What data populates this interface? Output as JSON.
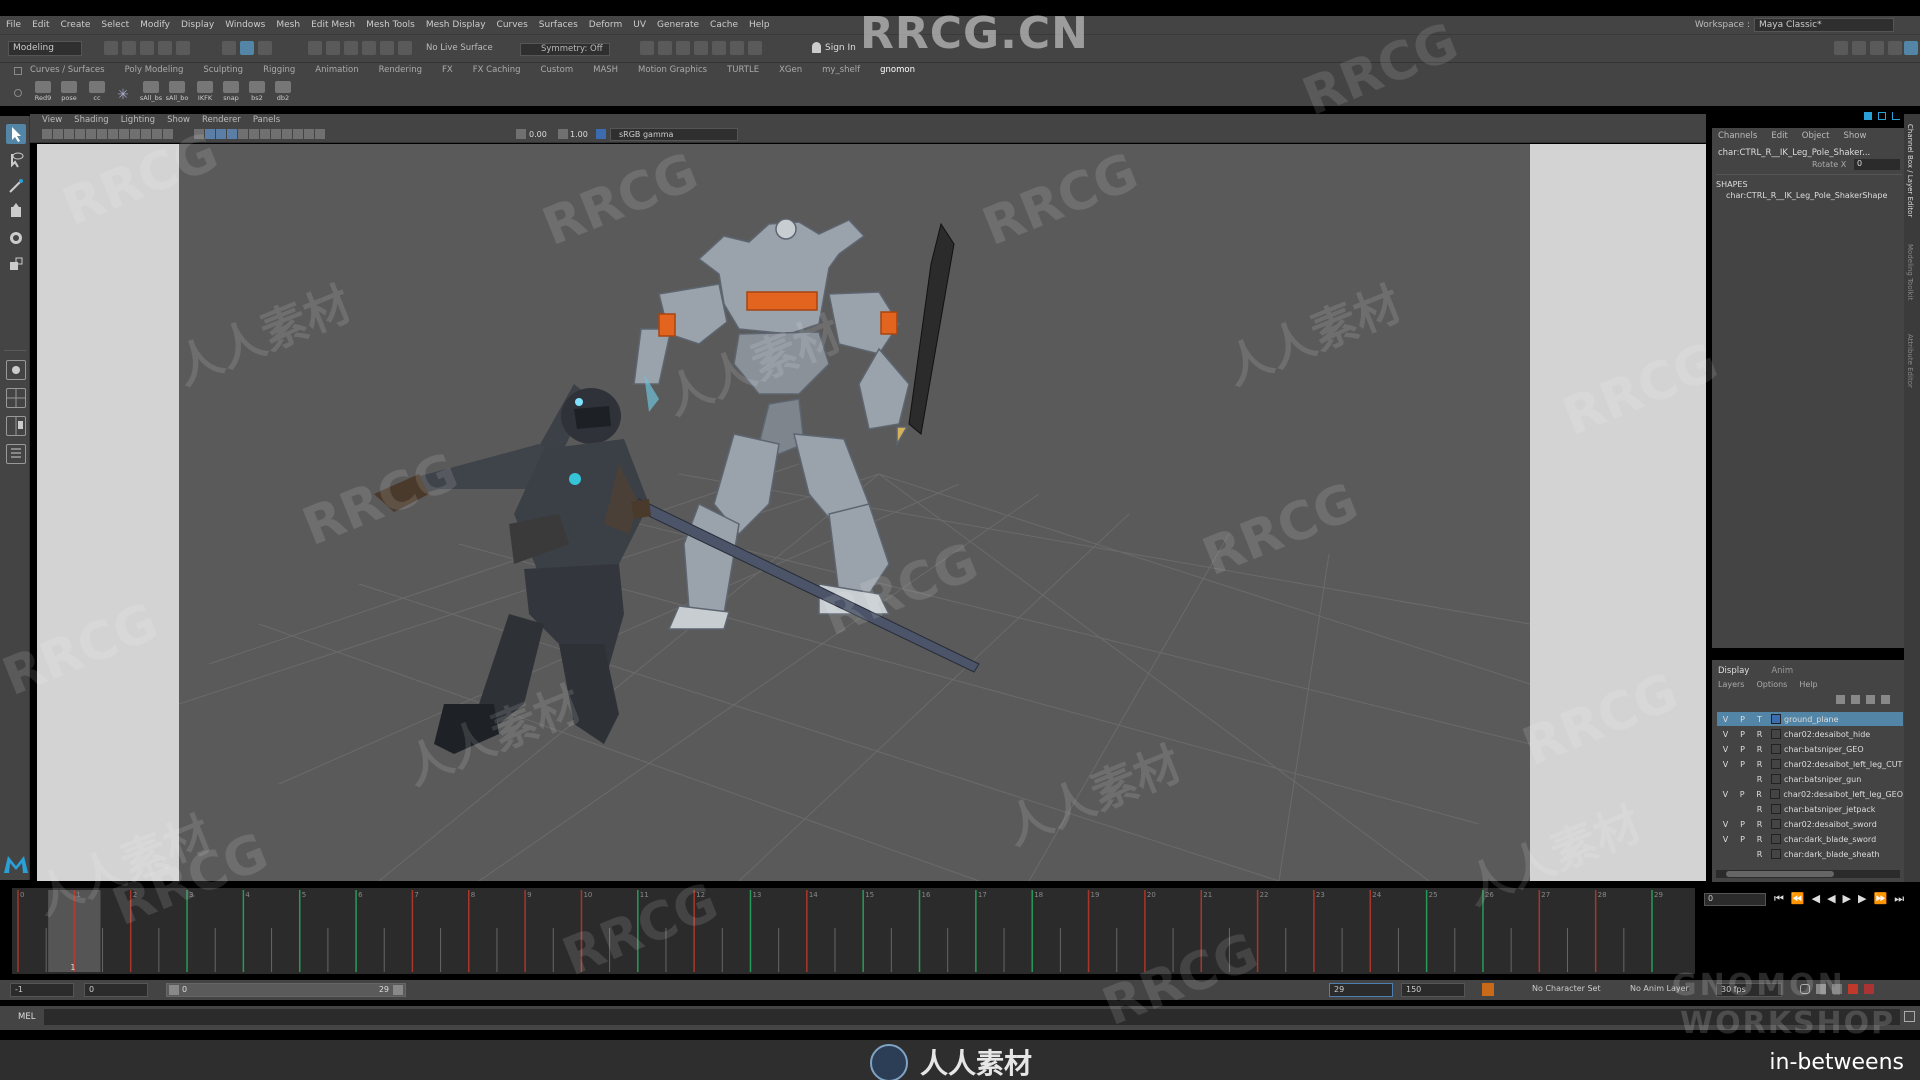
{
  "top_watermark": "RRCG.CN",
  "menus": [
    "File",
    "Edit",
    "Create",
    "Select",
    "Modify",
    "Display",
    "Windows",
    "Mesh",
    "Edit Mesh",
    "Mesh Tools",
    "Mesh Display",
    "Curves",
    "Surfaces",
    "Deform",
    "UV",
    "Generate",
    "Cache",
    "Help"
  ],
  "workspace": {
    "label": "Workspace :",
    "value": "Maya Classic*"
  },
  "status_line": {
    "mode": "Modeling",
    "live_surface": "No Live Surface",
    "symmetry": "Symmetry: Off",
    "sign_in": "Sign In"
  },
  "shelf": {
    "tabs": [
      "Curves / Surfaces",
      "Poly Modeling",
      "Sculpting",
      "Rigging",
      "Animation",
      "Rendering",
      "FX",
      "FX Caching",
      "Custom",
      "MASH",
      "Motion Graphics",
      "TURTLE",
      "XGen",
      "my_shelf",
      "gnomon"
    ],
    "active_tab": "gnomon",
    "buttons": [
      "Red9",
      "pose",
      "cc",
      "",
      "sAll_bs",
      "sAll_bo",
      "IKFK",
      "snap",
      "bs2",
      "db2"
    ]
  },
  "panel_menu": [
    "View",
    "Shading",
    "Lighting",
    "Show",
    "Renderer",
    "Panels"
  ],
  "panel_toolbar": {
    "exposure": "0.00",
    "gamma": "1.00",
    "color_space": "sRGB gamma"
  },
  "channel_box": {
    "tabs": [
      "Channels",
      "Edit",
      "Object",
      "Show"
    ],
    "object": "char:CTRL_R__IK_Leg_Pole_Shaker...",
    "attribute": {
      "name": "Rotate X",
      "value": "0"
    },
    "shapes_heading": "SHAPES",
    "shape": "char:CTRL_R__IK_Leg_Pole_ShakerShape"
  },
  "side_tabs": [
    "Channel Box / Layer Editor",
    "Modeling Toolkit",
    "Attribute Editor"
  ],
  "layer_editor": {
    "tabs": [
      "Display",
      "Anim"
    ],
    "menus": [
      "Layers",
      "Options",
      "Help"
    ],
    "layers": [
      {
        "v": "V",
        "p": "P",
        "r": "T",
        "name": "ground_plane",
        "color": "#3b6cb0",
        "selected": true
      },
      {
        "v": "V",
        "p": "P",
        "r": "R",
        "name": "char02:desaibot_hide",
        "color": "#444",
        "selected": false
      },
      {
        "v": "V",
        "p": "P",
        "r": "R",
        "name": "char:batsniper_GEO",
        "color": "#444",
        "selected": false
      },
      {
        "v": "V",
        "p": "P",
        "r": "R",
        "name": "char02:desaibot_left_leg_CUT",
        "color": "#444",
        "selected": false
      },
      {
        "v": "",
        "p": "",
        "r": "R",
        "name": "char:batsniper_gun",
        "color": "#444",
        "selected": false
      },
      {
        "v": "V",
        "p": "P",
        "r": "R",
        "name": "char02:desaibot_left_leg_GEO",
        "color": "#444",
        "selected": false
      },
      {
        "v": "",
        "p": "",
        "r": "R",
        "name": "char:batsniper_jetpack",
        "color": "#444",
        "selected": false
      },
      {
        "v": "V",
        "p": "P",
        "r": "R",
        "name": "char02:desaibot_sword",
        "color": "#444",
        "selected": false
      },
      {
        "v": "V",
        "p": "P",
        "r": "R",
        "name": "char:dark_blade_sword",
        "color": "#444",
        "selected": false
      },
      {
        "v": "",
        "p": "",
        "r": "R",
        "name": "char:dark_blade_sheath",
        "color": "#444",
        "selected": false
      }
    ]
  },
  "timeline": {
    "frames": [
      "0",
      "1",
      "2",
      "3",
      "4",
      "5",
      "6",
      "7",
      "8",
      "9",
      "10",
      "11",
      "12",
      "13",
      "14",
      "15",
      "16",
      "17",
      "18",
      "19",
      "20",
      "21",
      "22",
      "23",
      "24",
      "25",
      "26",
      "27",
      "28",
      "29"
    ],
    "current_frame": "1",
    "current_frame_field": "0",
    "key_colors": [
      "red",
      "red",
      "red",
      "green",
      "green",
      "green",
      "green",
      "red",
      "red",
      "red",
      "red",
      "green",
      "red",
      "green",
      "red",
      "green",
      "green",
      "green",
      "green",
      "red",
      "red",
      "red",
      "red",
      "red",
      "red",
      "green",
      "green",
      "red",
      "red",
      "green"
    ]
  },
  "range_slider": {
    "start": "-1",
    "anim_start": "0",
    "range_start": "0",
    "range_end": "29",
    "playback_end": "29",
    "anim_end": "150",
    "character_set": "No Character Set",
    "anim_layer": "No Anim Layer",
    "fps": "30 fps"
  },
  "command_line": {
    "label": "MEL"
  },
  "overlay": {
    "logo_text": "人人素材",
    "brand_line1": "GNOMON",
    "brand_line2": "WORKSHOP",
    "caption": "in-betweens",
    "watermark_text": "RRCG",
    "watermark_cn": "人人素材"
  },
  "colors": {
    "accent": "#5285a6",
    "ui_bg": "#444444",
    "viewport_bg": "#5a5a5a",
    "key_red": "#c0392b",
    "key_green": "#27ae60"
  }
}
